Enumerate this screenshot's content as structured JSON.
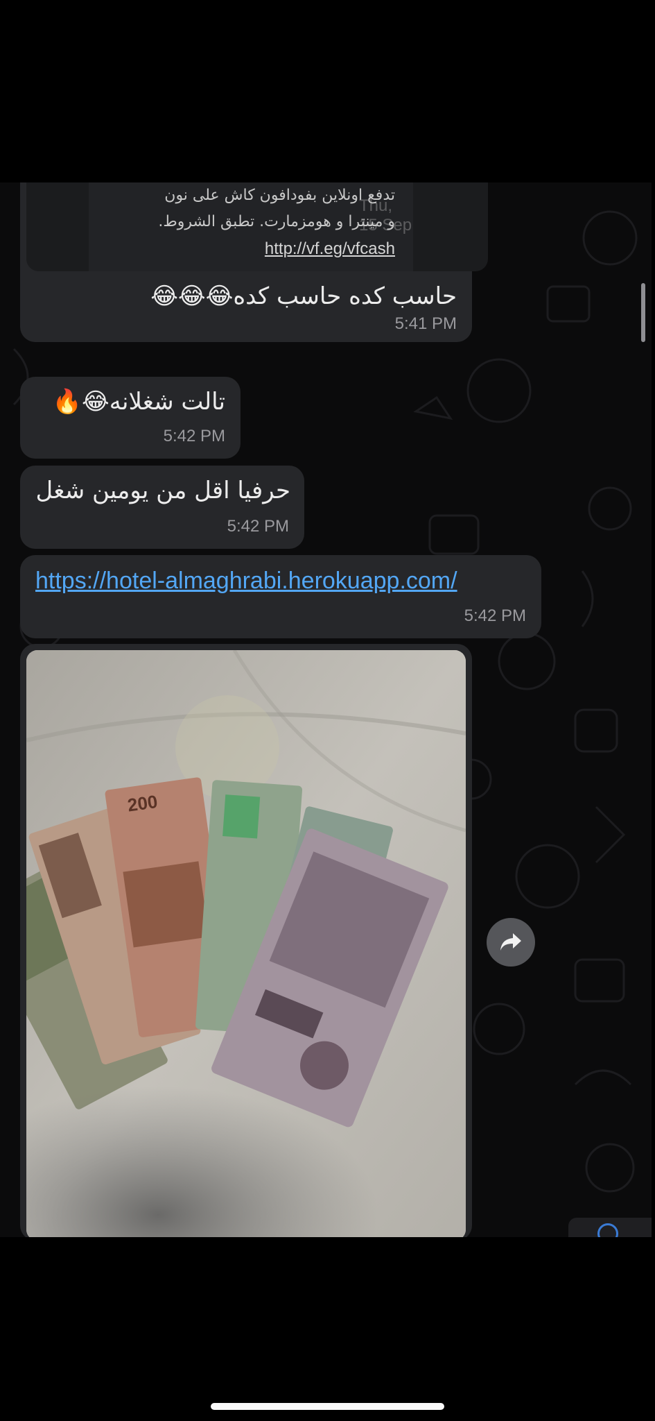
{
  "preview": {
    "line1": "تدفع اونلاين بفودافون كاش على نون",
    "line2": "و مينترا و هومزمارت. تطبق الشروط.",
    "link": "http://vf.eg/vfcash",
    "date_chip": "Thu, 15 Sep"
  },
  "messages": [
    {
      "text": "حاسب كده حاسب كده😂😂😂",
      "time": "5:41 PM"
    },
    {
      "text": "تالت شغلانه😂🔥",
      "time": "5:42 PM"
    },
    {
      "text": "حرفيا اقل من يومين شغل",
      "time": "5:42 PM"
    },
    {
      "link": "https://hotel-almaghrabi.herokuapp.com/",
      "time": "5:42 PM"
    }
  ],
  "photo": {
    "subject": "egyptian-banknotes-photo"
  },
  "icons": {
    "forward": "forward-arrow-icon"
  },
  "colors": {
    "bubble": "#26272a",
    "background": "#0b0b0c",
    "link": "#53a7f5",
    "time": "#9a9a9e"
  }
}
